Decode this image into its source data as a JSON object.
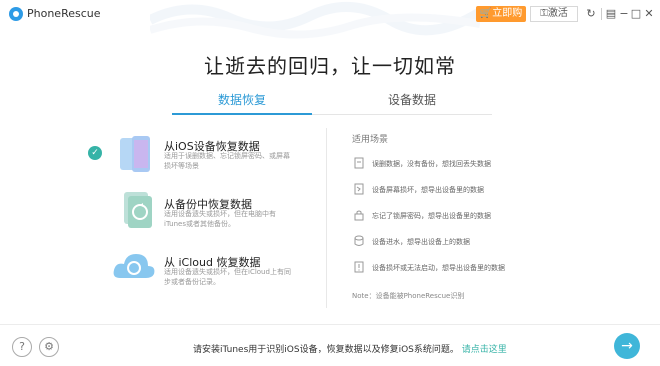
{
  "window": {
    "app_name": "PhoneRescue",
    "buy_label": "立即购买",
    "activate_label": "激活",
    "controls": [
      "↻",
      "▤",
      "−",
      "□",
      "✕"
    ]
  },
  "main": {
    "headline": "让逝去的回归，让一切如常",
    "tabs": [
      {
        "label": "数据恢复",
        "active": true
      },
      {
        "label": "设备数据",
        "active": false
      }
    ]
  },
  "options": [
    {
      "title": "从iOS设备恢复数据",
      "desc": "适用于误删数据、忘记锁屏密码、或屏幕损坏等场景",
      "selected": true
    },
    {
      "title": "从备份中恢复数据",
      "desc": "适用设备遗失或损坏，但在电脑中有iTunes或者其他备份。",
      "selected": false
    },
    {
      "title": "从 iCloud 恢复数据",
      "desc": "适用设备遗失或损坏，但在iCloud上有同步或者备份记录。",
      "selected": false
    }
  ],
  "scenarios": {
    "title": "适用场景",
    "items": [
      "误删数据，没有备份，想找回丢失数据",
      "设备屏幕损坏，想导出设备里的数据",
      "忘记了锁屏密码，想导出设备里的数据",
      "设备进水，想导出设备上的数据",
      "设备损坏或无法启动，想导出设备里的数据"
    ],
    "note": "Note：设备能被PhoneRescue识别"
  },
  "footer": {
    "message": "请安装iTunes用于识别iOS设备，恢复数据以及修复iOS系统问题。",
    "link": "请点击这里",
    "help_icon": "?",
    "settings_icon": "⚙",
    "next_icon": "→"
  },
  "colors": {
    "accent": "#2c9ad6",
    "buy": "#ff9a2e",
    "check": "#36b3a7",
    "next": "#3fb6d9"
  }
}
